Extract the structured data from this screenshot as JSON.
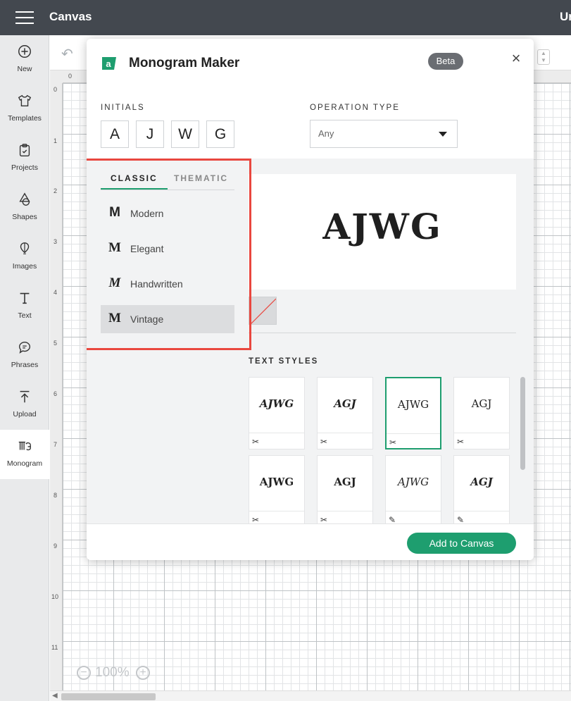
{
  "topbar": {
    "app_title": "Canvas",
    "doc_title": "Ur"
  },
  "sidebar": {
    "items": [
      {
        "label": "New",
        "icon": "plus-circle-icon"
      },
      {
        "label": "Templates",
        "icon": "shirt-icon"
      },
      {
        "label": "Projects",
        "icon": "clipboard-icon"
      },
      {
        "label": "Shapes",
        "icon": "shapes-icon"
      },
      {
        "label": "Images",
        "icon": "balloon-icon"
      },
      {
        "label": "Text",
        "icon": "text-icon"
      },
      {
        "label": "Phrases",
        "icon": "speech-bubble-icon"
      },
      {
        "label": "Upload",
        "icon": "upload-icon"
      },
      {
        "label": "Monogram",
        "icon": "monogram-icon"
      }
    ],
    "active": "Monogram"
  },
  "ruler": {
    "top": [
      "0"
    ],
    "left": [
      "0",
      "1",
      "2",
      "3",
      "4",
      "5",
      "6",
      "7",
      "8",
      "9",
      "10",
      "11"
    ]
  },
  "zoom": {
    "value": "100%"
  },
  "modal": {
    "title": "Monogram Maker",
    "badge": "Beta",
    "initials_label": "INITIALS",
    "initials": [
      "A",
      "J",
      "W",
      "G"
    ],
    "operation_label": "OPERATION TYPE",
    "operation_value": "Any",
    "tabs": {
      "classic": "CLASSIC",
      "thematic": "THEMATIC",
      "active": "CLASSIC"
    },
    "styles": [
      {
        "glyph": "M",
        "name": "Modern"
      },
      {
        "glyph": "M",
        "name": "Elegant"
      },
      {
        "glyph": "M",
        "name": "Handwritten"
      },
      {
        "glyph": "M",
        "name": "Vintage"
      }
    ],
    "selected_style": "Vintage",
    "preview_text": "AJWG",
    "text_styles_label": "TEXT STYLES",
    "text_styles": [
      {
        "sample": "AJWG",
        "tool": "scissors-icon"
      },
      {
        "sample": "AGJ",
        "tool": "scissors-icon"
      },
      {
        "sample": "AJWG",
        "tool": "scissors-icon"
      },
      {
        "sample": "AGJ",
        "tool": "scissors-icon"
      },
      {
        "sample": "AJWG",
        "tool": "scissors-icon"
      },
      {
        "sample": "AGJ",
        "tool": "scissors-icon"
      },
      {
        "sample": "AJWG",
        "tool": "pen-icon"
      },
      {
        "sample": "AGJ",
        "tool": "pen-icon"
      }
    ],
    "selected_text_style_index": 2,
    "add_button": "Add to Canvas"
  },
  "colors": {
    "accent": "#1e9e6f",
    "topbar": "#43484f",
    "highlight": "#e9473f"
  }
}
